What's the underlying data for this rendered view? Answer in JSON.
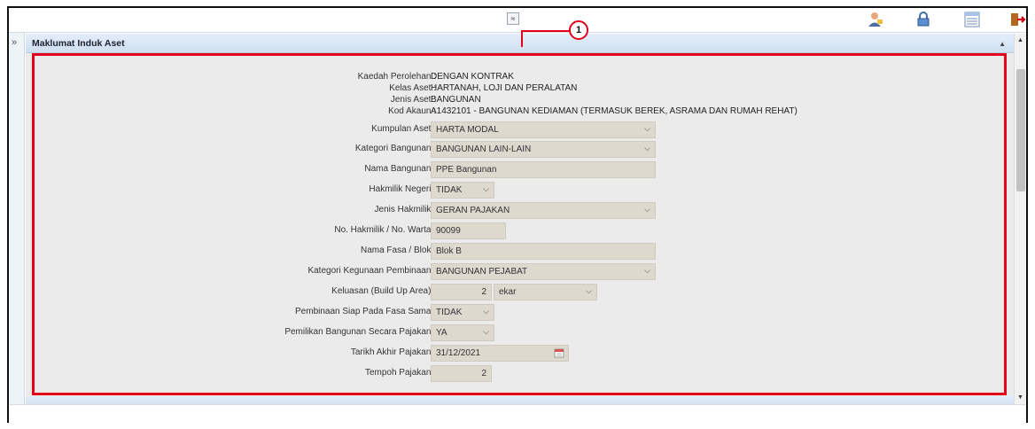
{
  "toolbar": {
    "collapse_glyph": "≈",
    "icons": [
      "user-icon",
      "lock-icon",
      "list-view-icon",
      "logout-icon"
    ]
  },
  "leftstrip": {
    "expand_glyph": "»"
  },
  "panel": {
    "title": "Maklumat Induk Aset",
    "caret_glyph": "▲"
  },
  "callout": {
    "number": "1"
  },
  "form": {
    "kaedah_perolehan": {
      "label": "Kaedah Perolehan :",
      "value": "DENGAN KONTRAK"
    },
    "kelas_aset": {
      "label": "Kelas Aset :",
      "value": "HARTANAH, LOJI DAN PERALATAN"
    },
    "jenis_aset": {
      "label": "Jenis Aset :",
      "value": "BANGUNAN"
    },
    "kod_akaun": {
      "label": "Kod Akaun :",
      "value": "A1432101 - BANGUNAN KEDIAMAN (TERMASUK BEREK, ASRAMA DAN RUMAH REHAT)"
    },
    "kumpulan_aset": {
      "label": "Kumpulan Aset :",
      "value": "HARTA MODAL"
    },
    "kategori_bangunan": {
      "label": "Kategori Bangunan :",
      "value": "BANGUNAN LAIN-LAIN"
    },
    "nama_bangunan": {
      "label": "Nama Bangunan :",
      "value": "PPE Bangunan"
    },
    "hakmilik_negeri": {
      "label": "Hakmilik Negeri :",
      "value": "TIDAK"
    },
    "jenis_hakmilik": {
      "label": "Jenis Hakmilik :",
      "value": "GERAN PAJAKAN"
    },
    "no_hakmilik": {
      "label": "No. Hakmilik / No. Warta :",
      "value": "90099"
    },
    "nama_fasa": {
      "label": "Nama Fasa / Blok :",
      "value": "Blok B"
    },
    "kategori_kegunaan": {
      "label": "Kategori Kegunaan Pembinaan :",
      "value": "BANGUNAN PEJABAT"
    },
    "keluasan": {
      "label": "Keluasan (Build Up Area) :",
      "value": "2",
      "unit": "ekar"
    },
    "pembinaan_siap": {
      "label": "Pembinaan Siap Pada Fasa Sama :",
      "value": "TIDAK"
    },
    "pemilikan_pajakan": {
      "label": "Pemilikan Bangunan Secara Pajakan :",
      "value": "YA"
    },
    "tarikh_akhir": {
      "label": "Tarikh Akhir Pajakan :",
      "value": "31/12/2021"
    },
    "tempoh_pajakan": {
      "label": "Tempoh Pajakan :",
      "value": "2"
    }
  },
  "colors": {
    "highlight": "#e2001a",
    "field_bg": "#ddd9cf",
    "panel_bg": "#ebebeb",
    "header_bg": "#d6e4f3"
  }
}
